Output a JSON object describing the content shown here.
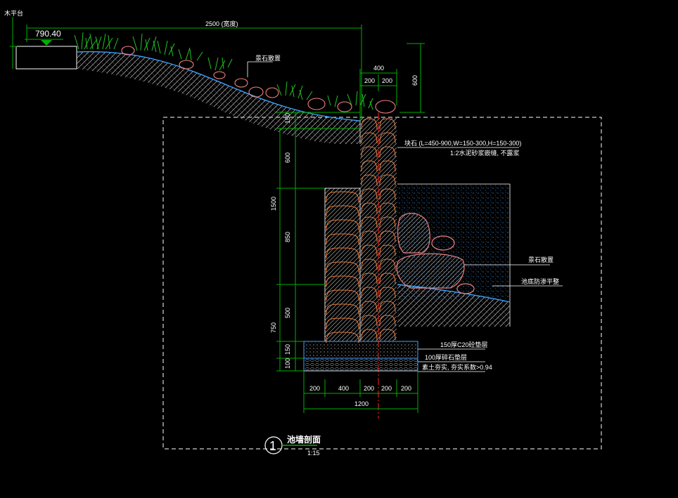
{
  "platform_label": "木平台",
  "elevation": "790.40",
  "top_width_dim": "2500 (宽度)",
  "landscape_stone_top": "景石散置",
  "wall_width_dim": "400",
  "wall_sub_dims": [
    "200",
    "200"
  ],
  "height_600_right": "600",
  "stone_spec": "块石 (L=450-900,W=150-300,H=150-300)",
  "mortar_spec": "1:2水泥砂浆嵌缝, 不露浆",
  "landscape_stone_pond": "景石散置",
  "pond_bottom_note": "池底防渗平整",
  "left_dims": [
    "150",
    "600",
    "1500",
    "850",
    "500",
    "750",
    "150",
    "100"
  ],
  "layer_concrete": "150厚C20砼垫层",
  "layer_gravel": "100厚碎石垫层",
  "layer_soil": "素土夯实, 夯实系数>0.94",
  "bottom_dims": [
    "200",
    "400",
    "200",
    "200",
    "200"
  ],
  "bottom_total": "1200",
  "detail_number": "1",
  "detail_title": "池墙剖面",
  "detail_scale": "1:15",
  "colors": {
    "dimension": "#00b000",
    "brick": "#e07a3a",
    "stone": "#f08080",
    "water": "#3aa0ff",
    "grass": "#22c322",
    "frame": "#ffffff",
    "axis": "#ff2020"
  }
}
